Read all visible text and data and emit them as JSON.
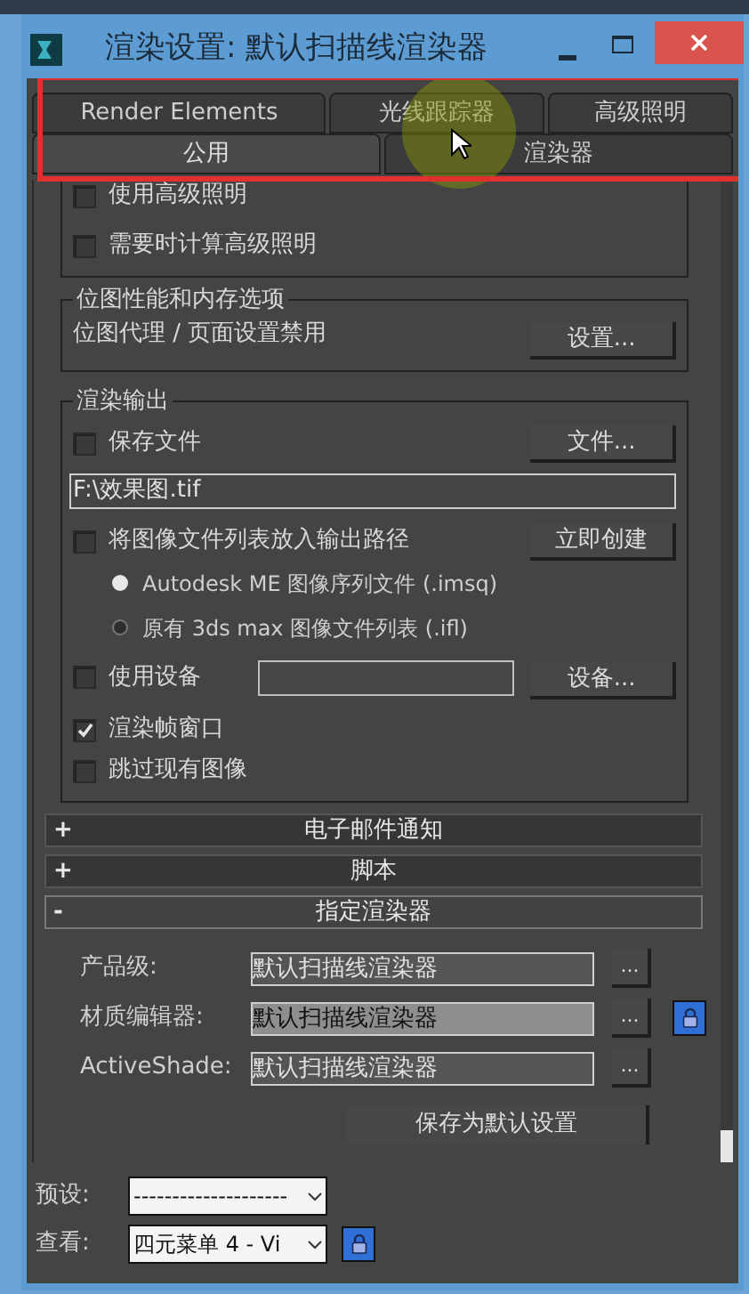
{
  "window": {
    "title": "渲染设置: 默认扫描线渲染器"
  },
  "tabs_row_1": [
    {
      "label": "Render Elements",
      "selected": false
    },
    {
      "label": "光线跟踪器",
      "selected": false
    },
    {
      "label": "高级照明",
      "selected": false
    }
  ],
  "tabs_row_2": [
    {
      "label": "公用",
      "selected": true
    },
    {
      "label": "渲染器",
      "selected": false
    }
  ],
  "advanced_lighting": {
    "checkboxes": [
      {
        "label": "使用高级照明",
        "checked": false
      },
      {
        "label": "需要时计算高级照明",
        "checked": false
      }
    ]
  },
  "bitmap_group": {
    "title": "位图性能和内存选项",
    "text": "位图代理 / 页面设置禁用",
    "button": "设置..."
  },
  "render_output": {
    "title": "渲染输出",
    "save_file": {
      "label": "保存文件",
      "checked": false
    },
    "files_button": "文件...",
    "path": "F:\\效果图.tif",
    "file_list": {
      "label": "将图像文件列表放入输出路径",
      "checked": false
    },
    "create_button": "立即创建",
    "radios": [
      {
        "label": "Autodesk ME 图像序列文件 (.imsq)",
        "selected": true
      },
      {
        "label": "原有 3ds max 图像文件列表 (.ifl)",
        "selected": false
      }
    ],
    "use_device": {
      "label": "使用设备",
      "checked": false
    },
    "device_button": "设备...",
    "options": [
      {
        "label": "渲染帧窗口",
        "checked": true
      },
      {
        "label": "跳过现有图像",
        "checked": false
      }
    ]
  },
  "rollouts": [
    {
      "sign": "+",
      "title": "电子邮件通知",
      "expanded": false
    },
    {
      "sign": "+",
      "title": "脚本",
      "expanded": false
    },
    {
      "sign": "-",
      "title": "指定渲染器",
      "expanded": true
    }
  ],
  "assign_renderer": {
    "rows": [
      {
        "label": "产品级:",
        "value": "默认扫描线渲染器",
        "lock": false
      },
      {
        "label": "材质编辑器:",
        "value": "默认扫描线渲染器",
        "lock": true
      },
      {
        "label": "ActiveShade:",
        "value": "默认扫描线渲染器",
        "lock": false
      }
    ],
    "browse_button": "...",
    "save_default_button": "保存为默认设置"
  },
  "footer": {
    "preset": {
      "label": "预设:",
      "value": "--------------------"
    },
    "view": {
      "label": "查看:",
      "value": "四元菜单 4 - Vi"
    }
  }
}
